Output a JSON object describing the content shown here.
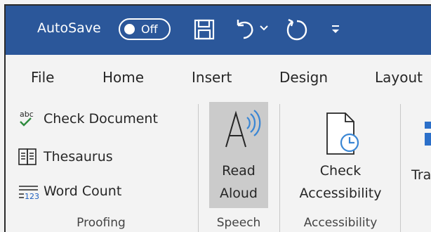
{
  "titlebar": {
    "autosave_label": "AutoSave",
    "toggle_state": "Off",
    "icons": [
      "save-icon",
      "undo-icon",
      "undo-dropdown-icon",
      "redo-icon",
      "customize-qat-icon"
    ],
    "accent_color": "#2b579a"
  },
  "tabs": [
    "File",
    "Home",
    "Insert",
    "Design",
    "Layout"
  ],
  "ribbon": {
    "proofing": {
      "items": [
        {
          "icon_text": "abc",
          "label": "Check Document"
        },
        {
          "label": "Thesaurus"
        },
        {
          "icon_text": "123",
          "label": "Word Count"
        }
      ],
      "group_label": "Proofing"
    },
    "speech": {
      "button_line1": "Read",
      "button_line2": "Aloud",
      "group_label": "Speech"
    },
    "accessibility": {
      "button_line1": "Check",
      "button_line2": "Accessibility",
      "group_label": "Accessibility"
    },
    "partial_label": "Tra"
  }
}
